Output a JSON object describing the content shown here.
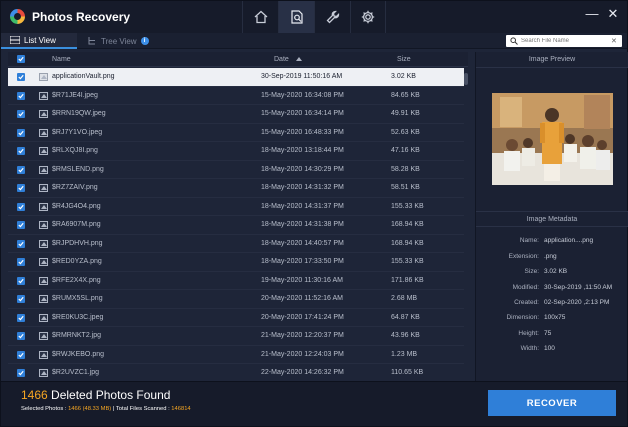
{
  "titlebar": {
    "app_title": "Photos Recovery",
    "nav_tabs": [
      {
        "icon": "home-icon"
      },
      {
        "icon": "scan-search-icon",
        "active": true
      },
      {
        "icon": "wrench-icon"
      },
      {
        "icon": "gear-icon"
      }
    ],
    "controls": {
      "minimize": "—",
      "close": "✕"
    }
  },
  "viewbar": {
    "list_view_label": "List View",
    "tree_view_label": "Tree View",
    "tree_view_info": "i",
    "search_placeholder": "Search File Name"
  },
  "list": {
    "columns": {
      "name": "Name",
      "date": "Date",
      "size": "Size"
    },
    "rows": [
      {
        "name": "applicationVault.png",
        "date": "30-Sep-2019 11:50:16 AM",
        "size": "3.02 KB",
        "selected": true
      },
      {
        "name": "$R71JE4I.jpeg",
        "date": "15-May-2020 16:34:08 PM",
        "size": "84.65 KB"
      },
      {
        "name": "$RRN19QW.jpeg",
        "date": "15-May-2020 16:34:14 PM",
        "size": "49.91 KB"
      },
      {
        "name": "$RJ7Y1VO.jpeg",
        "date": "15-May-2020 16:48:33 PM",
        "size": "52.63 KB"
      },
      {
        "name": "$RLXQJ8I.png",
        "date": "18-May-2020 13:18:44 PM",
        "size": "47.16 KB"
      },
      {
        "name": "$RMSLEND.png",
        "date": "18-May-2020 14:30:29 PM",
        "size": "58.28 KB"
      },
      {
        "name": "$RZ7ZAIV.png",
        "date": "18-May-2020 14:31:32 PM",
        "size": "58.51 KB"
      },
      {
        "name": "$R4JG4O4.png",
        "date": "18-May-2020 14:31:37 PM",
        "size": "155.33 KB"
      },
      {
        "name": "$RA6907M.png",
        "date": "18-May-2020 14:31:38 PM",
        "size": "168.94 KB"
      },
      {
        "name": "$RJPDHVH.png",
        "date": "18-May-2020 14:40:57 PM",
        "size": "168.94 KB"
      },
      {
        "name": "$RED0YZA.png",
        "date": "18-May-2020 17:33:50 PM",
        "size": "155.33 KB"
      },
      {
        "name": "$RFE2X4X.png",
        "date": "19-May-2020 11:30:16 AM",
        "size": "171.86 KB"
      },
      {
        "name": "$RUMX5SL.png",
        "date": "20-May-2020 11:52:16 AM",
        "size": "2.68 MB"
      },
      {
        "name": "$RE0KU3C.jpeg",
        "date": "20-May-2020 17:41:24 PM",
        "size": "64.87 KB"
      },
      {
        "name": "$RMRNKT2.jpg",
        "date": "21-May-2020 12:20:37 PM",
        "size": "43.96 KB"
      },
      {
        "name": "$RWJKEBO.png",
        "date": "21-May-2020 12:24:03 PM",
        "size": "1.23 MB"
      },
      {
        "name": "$R2UVZC1.jpg",
        "date": "22-May-2020 14:26:32 PM",
        "size": "110.65 KB"
      }
    ]
  },
  "preview": {
    "title": "Image Preview",
    "metadata_title": "Image Metadata",
    "metadata": [
      {
        "key": "Name:",
        "value": "application....png"
      },
      {
        "key": "Extension:",
        "value": ".png"
      },
      {
        "key": "Size:",
        "value": "3.02 KB"
      },
      {
        "key": "Modified:",
        "value": "30-Sep-2019 ,11:50 AM"
      },
      {
        "key": "Created:",
        "value": "02-Sep-2020 ,2:13 PM"
      },
      {
        "key": "Dimension:",
        "value": "100x75"
      },
      {
        "key": "Height:",
        "value": "75"
      },
      {
        "key": "Width:",
        "value": "100"
      }
    ]
  },
  "footer": {
    "found_count": "1466",
    "found_label": " Deleted Photos Found",
    "selected_label": "Selected Photos : ",
    "selected_value": "1466 (48.33 MB)",
    "separator": " | ",
    "scanned_label": "Total Files Scanned : ",
    "scanned_value": "146814",
    "recover_label": "RECOVER"
  },
  "colors": {
    "accent": "#2f7fd8",
    "highlight": "#f5a623",
    "background": "#1e2538"
  }
}
